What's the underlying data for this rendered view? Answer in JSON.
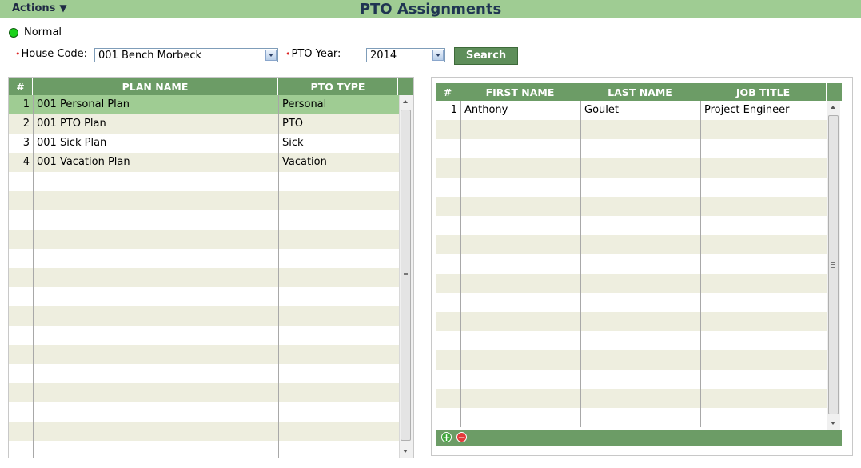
{
  "header": {
    "actions_label": "Actions",
    "actions_caret": "▼",
    "title": "PTO Assignments"
  },
  "status": {
    "label": "Normal",
    "color": "#1bd21b"
  },
  "filters": {
    "required_mark": "•",
    "house_code_label": "House Code:",
    "house_code_value": "001 Bench Morbeck",
    "pto_year_label": "PTO Year:",
    "pto_year_value": "2014",
    "search_label": "Search"
  },
  "plans_grid": {
    "columns": [
      "#",
      "PLAN NAME",
      "PTO TYPE"
    ],
    "rows": [
      {
        "num": "1",
        "plan_name": "001 Personal Plan",
        "pto_type": "Personal"
      },
      {
        "num": "2",
        "plan_name": "001 PTO Plan",
        "pto_type": "PTO"
      },
      {
        "num": "3",
        "plan_name": "001 Sick Plan",
        "pto_type": "Sick"
      },
      {
        "num": "4",
        "plan_name": "001 Vacation Plan",
        "pto_type": "Vacation"
      }
    ],
    "selected_index": 0
  },
  "employees_grid": {
    "columns": [
      "#",
      "FIRST NAME",
      "LAST NAME",
      "JOB TITLE"
    ],
    "rows": [
      {
        "num": "1",
        "first_name": "Anthony",
        "last_name": "Goulet",
        "job_title": "Project Engineer"
      }
    ],
    "footer": {
      "add_icon": "add-icon",
      "remove_icon": "remove-icon"
    }
  },
  "colors": {
    "title_bar": "#9fcc93",
    "grid_header": "#6c9c66",
    "row_alt": "#eeeedf",
    "row_selected": "#9fcc93",
    "button": "#5e8e5a"
  }
}
